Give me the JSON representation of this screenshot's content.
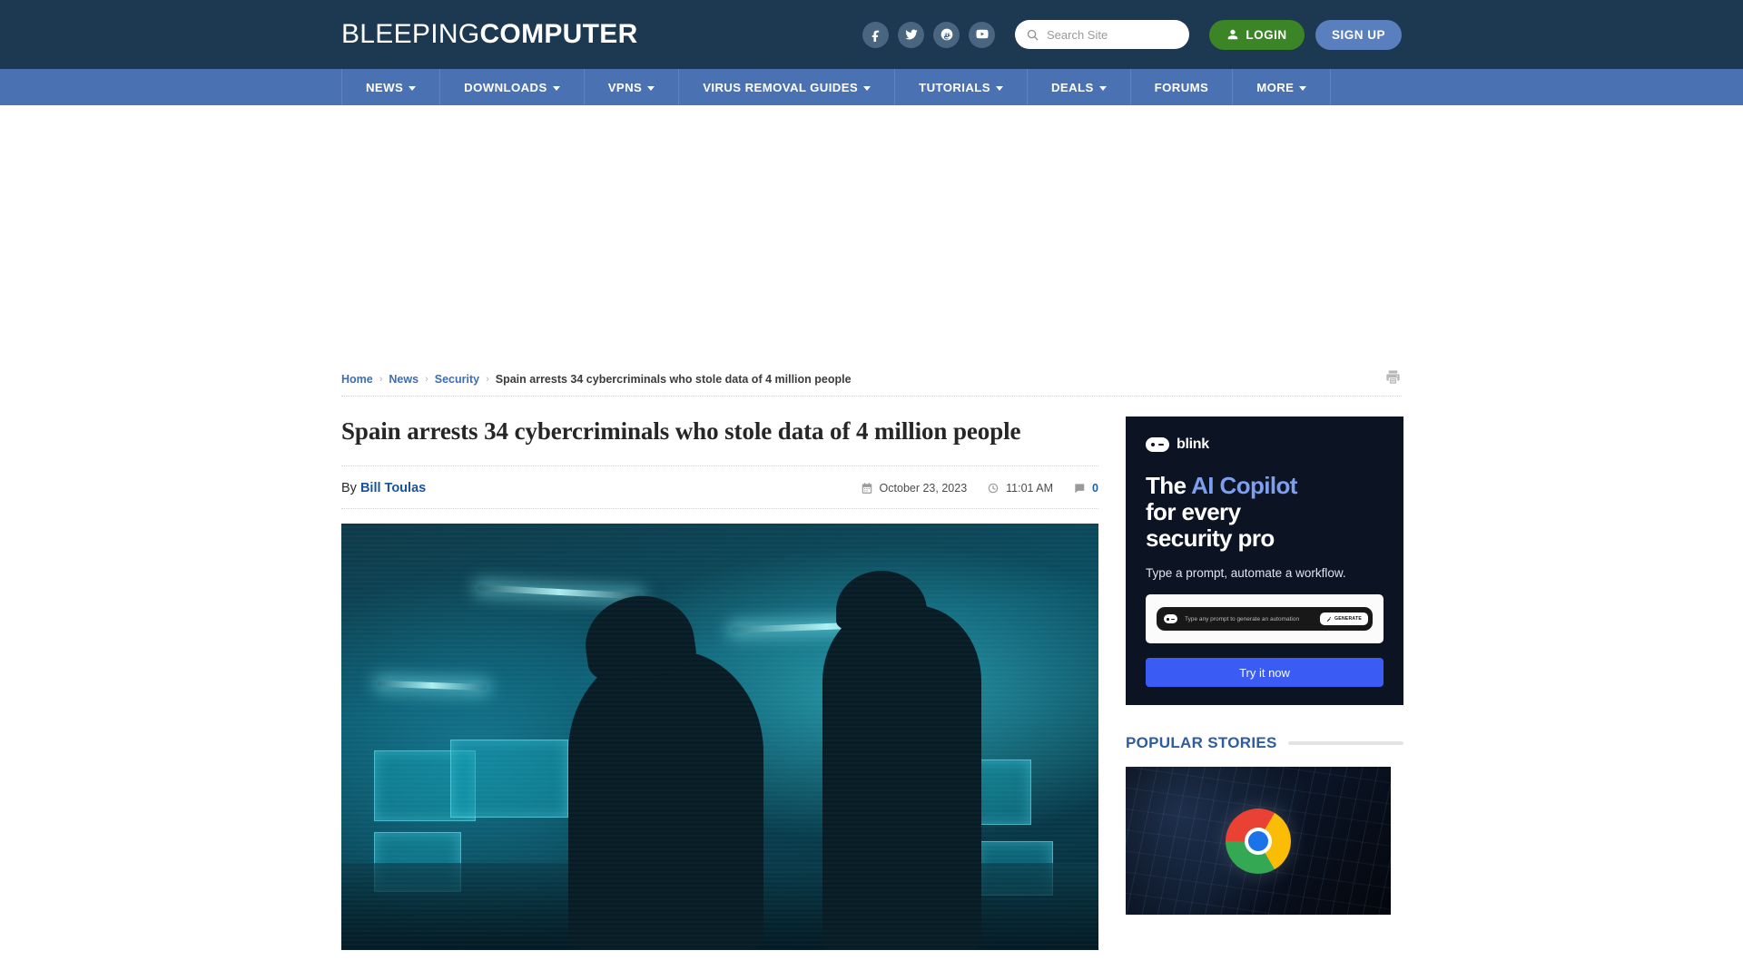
{
  "header": {
    "logo_light": "BLEEPING",
    "logo_bold": "COMPUTER",
    "social": [
      {
        "name": "facebook-icon",
        "label": "Facebook"
      },
      {
        "name": "twitter-icon",
        "label": "Twitter"
      },
      {
        "name": "mastodon-icon",
        "label": "Mastodon"
      },
      {
        "name": "youtube-icon",
        "label": "YouTube"
      }
    ],
    "search": {
      "placeholder": "Search Site",
      "value": ""
    },
    "login_label": "LOGIN",
    "signup_label": "SIGN UP",
    "colors": {
      "header_bg": "#1d3951",
      "nav_bg": "#4a72b2",
      "login_green": "#3c8527",
      "signup_blue": "#5a7fbe"
    }
  },
  "nav": {
    "items": [
      {
        "label": "NEWS",
        "has_dropdown": true
      },
      {
        "label": "DOWNLOADS",
        "has_dropdown": true
      },
      {
        "label": "VPNS",
        "has_dropdown": true
      },
      {
        "label": "VIRUS REMOVAL GUIDES",
        "has_dropdown": true
      },
      {
        "label": "TUTORIALS",
        "has_dropdown": true
      },
      {
        "label": "DEALS",
        "has_dropdown": true
      },
      {
        "label": "FORUMS",
        "has_dropdown": false
      },
      {
        "label": "MORE",
        "has_dropdown": true
      }
    ]
  },
  "breadcrumb": {
    "home": "Home",
    "news": "News",
    "security": "Security",
    "current": "Spain arrests 34 cybercriminals who stole data of 4 million people",
    "separator": "›",
    "print_icon": "printer-icon"
  },
  "article": {
    "title": "Spain arrests 34 cybercriminals who stole data of 4 million people",
    "by_label": "By",
    "author": "Bill Toulas",
    "date": "October 23, 2023",
    "time": "11:01 AM",
    "comment_count": "0"
  },
  "sidebar": {
    "ad": {
      "brand": "blink",
      "headline_part1": "The ",
      "headline_accent": "AI Copilot",
      "headline_part2": "for every",
      "headline_part3": "security pro",
      "subtitle": "Type a prompt, automate a workflow.",
      "prompt_placeholder": "Type any prompt to generate an automation",
      "generate_label": "GENERATE",
      "cta_label": "Try it now",
      "colors": {
        "background": "#0c1322",
        "accent": "#7e9ff0",
        "cta": "#3b5bf5"
      }
    },
    "popular": {
      "title": "POPULAR STORIES",
      "thumb_alt": "chrome-browser-thumbnail"
    }
  }
}
